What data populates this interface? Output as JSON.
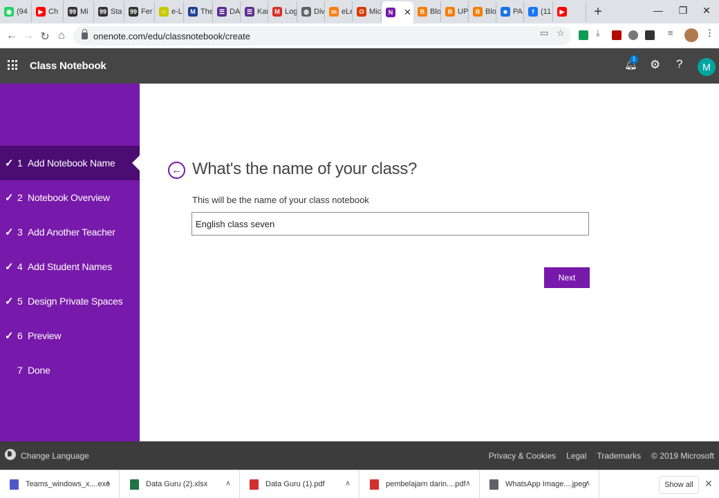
{
  "browser": {
    "tabs": [
      {
        "label": "(94",
        "icon": "whatsapp-icon",
        "color": "#25d366",
        "glyph": "◉"
      },
      {
        "label": "Ch",
        "icon": "youtube-icon",
        "color": "#ff0000",
        "glyph": "▶"
      },
      {
        "label": "Mi",
        "icon": "quizizz-icon",
        "color": "#333333",
        "glyph": "99"
      },
      {
        "label": "Sta",
        "icon": "quizizz-icon",
        "color": "#333333",
        "glyph": "99"
      },
      {
        "label": "Fer",
        "icon": "quizizz-icon",
        "color": "#333333",
        "glyph": "99"
      },
      {
        "label": "e-L",
        "icon": "elearning-icon",
        "color": "#c8c800",
        "glyph": "☺"
      },
      {
        "label": "The",
        "icon": "mt-icon",
        "color": "#1d3f8f",
        "glyph": "M"
      },
      {
        "label": "DA",
        "icon": "forms-icon",
        "color": "#5c2d91",
        "glyph": "☰"
      },
      {
        "label": "Kar",
        "icon": "forms-icon",
        "color": "#5c2d91",
        "glyph": "☰"
      },
      {
        "label": "Log",
        "icon": "gmail-icon",
        "color": "#d93025",
        "glyph": "M"
      },
      {
        "label": "Div",
        "icon": "globe-icon",
        "color": "#5f6368",
        "glyph": "◍"
      },
      {
        "label": "eLe",
        "icon": "moodle-icon",
        "color": "#f98012",
        "glyph": "m"
      },
      {
        "label": "Mic",
        "icon": "office-icon",
        "color": "#d83b01",
        "glyph": "O"
      },
      {
        "label": "",
        "icon": "onenote-icon",
        "color": "#7719aa",
        "glyph": "N",
        "active": true
      },
      {
        "label": "Blo",
        "icon": "blogger-icon",
        "color": "#f57c00",
        "glyph": "B"
      },
      {
        "label": "UP",
        "icon": "blogger-icon",
        "color": "#f57c00",
        "glyph": "B"
      },
      {
        "label": "Blo",
        "icon": "blogger-icon",
        "color": "#f57c00",
        "glyph": "B"
      },
      {
        "label": "PA",
        "icon": "contacts-icon",
        "color": "#1a73e8",
        "glyph": "☻"
      },
      {
        "label": "(11",
        "icon": "facebook-icon",
        "color": "#1877f2",
        "glyph": "f"
      },
      {
        "label": "",
        "icon": "youtube-icon",
        "color": "#ff0000",
        "glyph": "▶"
      }
    ],
    "new_tab": "+",
    "url": "onenote.com/edu/classnotebook/create"
  },
  "app": {
    "title": "Class Notebook",
    "notification_count": "1",
    "avatar_initial": "M",
    "accent": "#7719aa",
    "sidebar_active": "#4b0c73"
  },
  "steps": [
    {
      "number": "1",
      "label": "Add Notebook Name",
      "done": true,
      "active": true
    },
    {
      "number": "2",
      "label": "Notebook Overview",
      "done": true,
      "active": false
    },
    {
      "number": "3",
      "label": "Add Another Teacher",
      "done": true,
      "active": false
    },
    {
      "number": "4",
      "label": "Add Student Names",
      "done": true,
      "active": false
    },
    {
      "number": "5",
      "label": "Design Private Spaces",
      "done": true,
      "active": false
    },
    {
      "number": "6",
      "label": "Preview",
      "done": true,
      "active": false
    },
    {
      "number": "7",
      "label": "Done",
      "done": false,
      "active": false
    }
  ],
  "form": {
    "heading": "What's the name of your class?",
    "sublabel": "This will be the name of your class notebook",
    "class_name_value": "English class seven",
    "next_label": "Next"
  },
  "footer": {
    "change_language": "Change Language",
    "links": [
      "Privacy & Cookies",
      "Legal",
      "Trademarks",
      "© 2019 Microsoft"
    ]
  },
  "downloads": {
    "items": [
      {
        "name": "Teams_windows_x....exe",
        "icon": "teams-icon",
        "color": "#5059c9"
      },
      {
        "name": "Data Guru (2).xlsx",
        "icon": "excel-icon",
        "color": "#217346"
      },
      {
        "name": "Data Guru (1).pdf",
        "icon": "pdf-icon",
        "color": "#d32f2f"
      },
      {
        "name": "pembelajarn darin....pdf",
        "icon": "pdf-icon",
        "color": "#d32f2f"
      },
      {
        "name": "WhatsApp Image....jpeg",
        "icon": "image-file-icon",
        "color": "#5f6368"
      }
    ],
    "show_all": "Show all"
  }
}
